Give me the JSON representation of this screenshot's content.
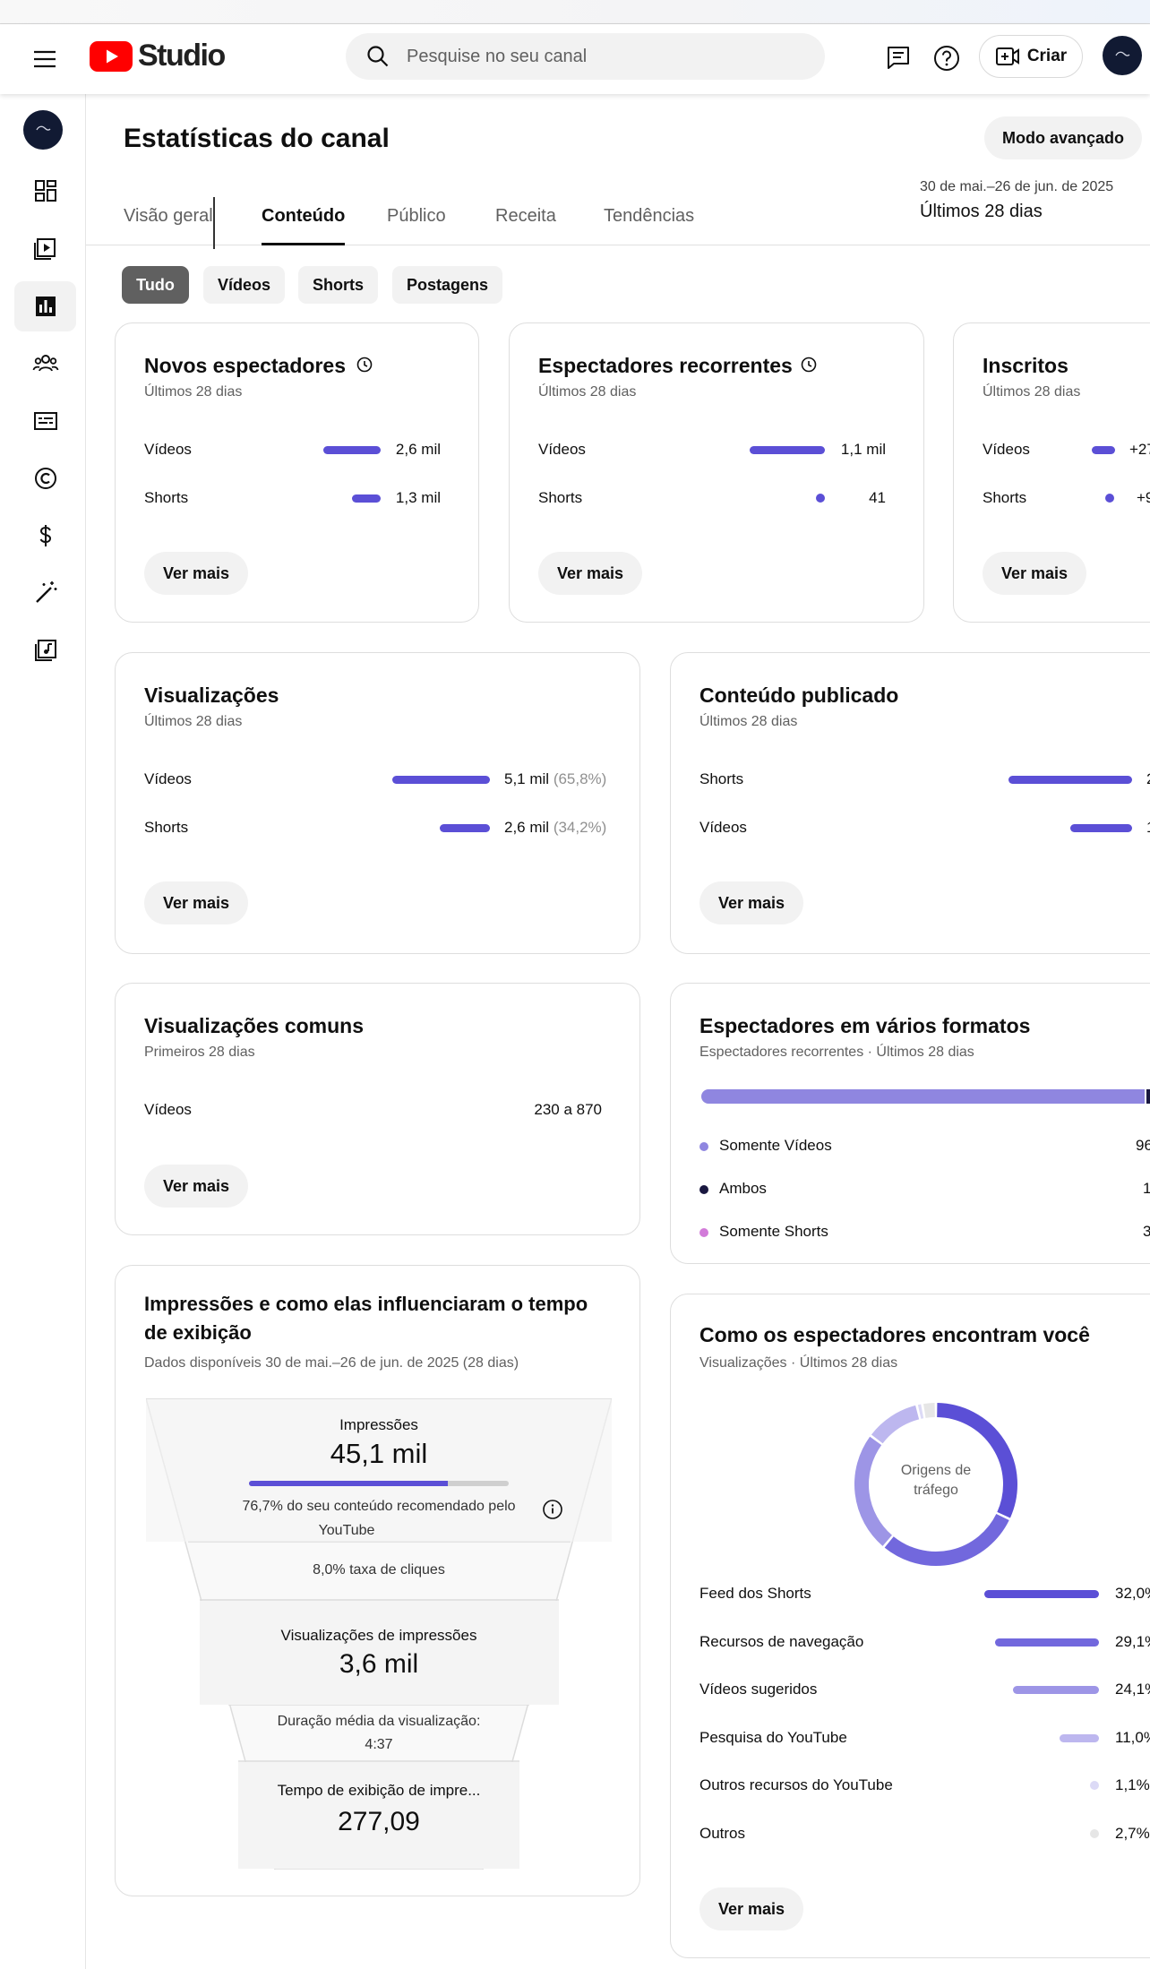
{
  "header": {
    "logo_text": "Studio",
    "search_placeholder": "Pesquise no seu canal",
    "create_label": "Criar"
  },
  "page": {
    "title": "Estatísticas do canal",
    "advanced_label": "Modo avançado",
    "date_range": "30 de mai.–26 de jun. de 2025",
    "period": "Últimos 28 dias"
  },
  "tabs": [
    "Visão geral",
    "Conteúdo",
    "Público",
    "Receita",
    "Tendências"
  ],
  "chips": [
    "Tudo",
    "Vídeos",
    "Shorts",
    "Postagens"
  ],
  "accent_color": "#5b4fd6",
  "more_label": "Ver mais",
  "cards": {
    "new_viewers": {
      "title": "Novos espectadores",
      "subtitle": "Últimos 28 dias",
      "rows": [
        {
          "label": "Vídeos",
          "value": "2,6 mil"
        },
        {
          "label": "Shorts",
          "value": "1,3 mil"
        }
      ]
    },
    "returning": {
      "title": "Espectadores recorrentes",
      "subtitle": "Últimos 28 dias",
      "rows": [
        {
          "label": "Vídeos",
          "value": "1,1 mil"
        },
        {
          "label": "Shorts",
          "value": "41"
        }
      ]
    },
    "subscribers": {
      "title": "Inscritos",
      "subtitle": "Últimos 28 dias",
      "rows": [
        {
          "label": "Vídeos",
          "value": "+27"
        },
        {
          "label": "Shorts",
          "value": "+9"
        }
      ]
    },
    "views": {
      "title": "Visualizações",
      "subtitle": "Últimos 28 dias",
      "rows": [
        {
          "label": "Vídeos",
          "value": "5,1 mil",
          "pct": "(65,8%)"
        },
        {
          "label": "Shorts",
          "value": "2,6 mil",
          "pct": "(34,2%)"
        }
      ]
    },
    "published": {
      "title": "Conteúdo publicado",
      "subtitle": "Últimos 28 dias",
      "rows": [
        {
          "label": "Shorts",
          "value": "2"
        },
        {
          "label": "Vídeos",
          "value": "1"
        }
      ]
    },
    "common_views": {
      "title": "Visualizações comuns",
      "subtitle": "Primeiros 28 dias",
      "rows": [
        {
          "label": "Vídeos",
          "value": "230 a 870"
        }
      ]
    },
    "multi_format": {
      "title": "Espectadores em vários formatos",
      "subtitle": "Espectadores recorrentes · Últimos 28 dias",
      "items": [
        {
          "label": "Somente Vídeos",
          "value": "96",
          "color": "#8f86e0"
        },
        {
          "label": "Ambos",
          "value": "1",
          "color": "#1a1840"
        },
        {
          "label": "Somente Shorts",
          "value": "3",
          "color": "#d27bd9"
        }
      ]
    },
    "impressions": {
      "title_line1": "Impressões e como elas influenciaram o tempo",
      "title_line2": "de exibição",
      "subtitle": "Dados disponíveis 30 de mai.–26 de jun. de 2025 (28 dias)",
      "impressions_label": "Impressões",
      "impressions_value": "45,1 mil",
      "recommended_pct": 76.7,
      "recommended_line1": "76,7% do seu conteúdo recomendado pelo",
      "recommended_line2": "YouTube",
      "ctr": "8,0% taxa de cliques",
      "imp_views_label": "Visualizações de impressões",
      "imp_views_value": "3,6 mil",
      "avg_duration_line1": "Duração média da visualização:",
      "avg_duration_line2": "4:37",
      "watch_time_label": "Tempo de exibição de impre...",
      "watch_time_value": "277,09"
    },
    "traffic": {
      "title": "Como os espectadores encontram você",
      "subtitle": "Visualizações · Últimos 28 dias",
      "donut_line1": "Origens de",
      "donut_line2": "tráfego"
    }
  },
  "chart_data": {
    "type": "pie",
    "sources": [
      {
        "label": "Feed dos Shorts",
        "value": 32.0,
        "display": "32,0%",
        "color": "#5b4fd6"
      },
      {
        "label": "Recursos de navegação",
        "value": 29.1,
        "display": "29,1%",
        "color": "#7268dd"
      },
      {
        "label": "Vídeos sugeridos",
        "value": 24.1,
        "display": "24,1%",
        "color": "#9d95e6"
      },
      {
        "label": "Pesquisa do YouTube",
        "value": 11.0,
        "display": "11,0%",
        "color": "#bdb7ef"
      },
      {
        "label": "Outros recursos do YouTube",
        "value": 1.1,
        "display": "1,1%",
        "color": "#dcdaf6"
      },
      {
        "label": "Outros",
        "value": 2.7,
        "display": "2,7%",
        "color": "#e6e6e6"
      }
    ]
  }
}
